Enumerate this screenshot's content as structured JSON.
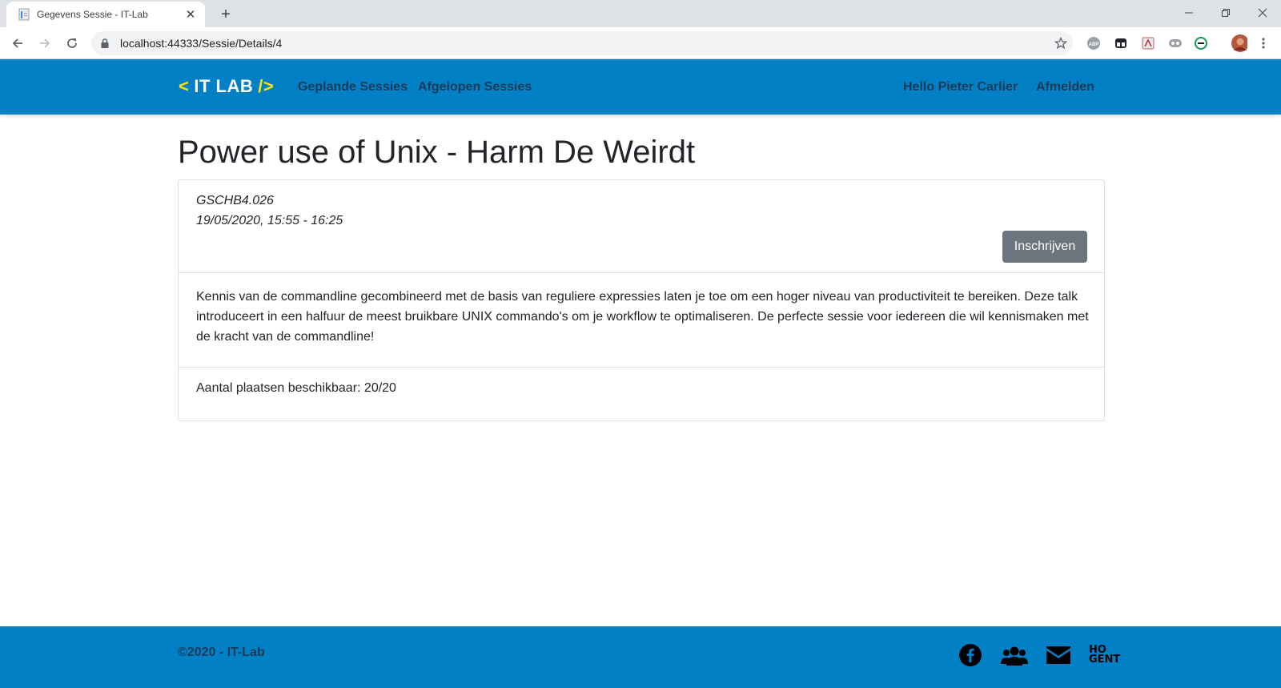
{
  "browser": {
    "tab_title": "Gegevens Sessie - IT-Lab",
    "url": "localhost:44333/Sessie/Details/4"
  },
  "header": {
    "logo_left": "<",
    "logo_text": "IT LAB",
    "logo_right": "/>",
    "nav": [
      "Geplande Sessies",
      "Afgelopen Sessies"
    ],
    "greeting": "Hello Pieter Carlier",
    "logout": "Afmelden"
  },
  "session": {
    "title": "Power use of Unix - Harm De Weirdt",
    "location": "GSCHB4.026",
    "datetime": "19/05/2020, 15:55 - 16:25",
    "enroll_label": "Inschrijven",
    "description": "Kennis van de commandline gecombineerd met de basis van reguliere expressies laten je toe om een hoger niveau van productiviteit te bereiken. Deze talk introduceert in een halfuur de meest bruikbare UNIX commando's om je workflow te optimaliseren. De perfecte sessie voor iedereen die wil kennismaken met de kracht van de commandline!",
    "seats": "Aantal plaatsen beschikbaar: 20/20"
  },
  "footer": {
    "copyright": "©2020 - IT-Lab",
    "icons": [
      "facebook-icon",
      "group-icon",
      "mail-icon",
      "hogent-logo"
    ],
    "hogent_line1": "HO",
    "hogent_line2": "GENT"
  },
  "colors": {
    "brand_blue": "#0280c6",
    "logo_yellow": "#ffe300",
    "nav_text": "#1b3a57",
    "button_gray": "#6c757d"
  }
}
